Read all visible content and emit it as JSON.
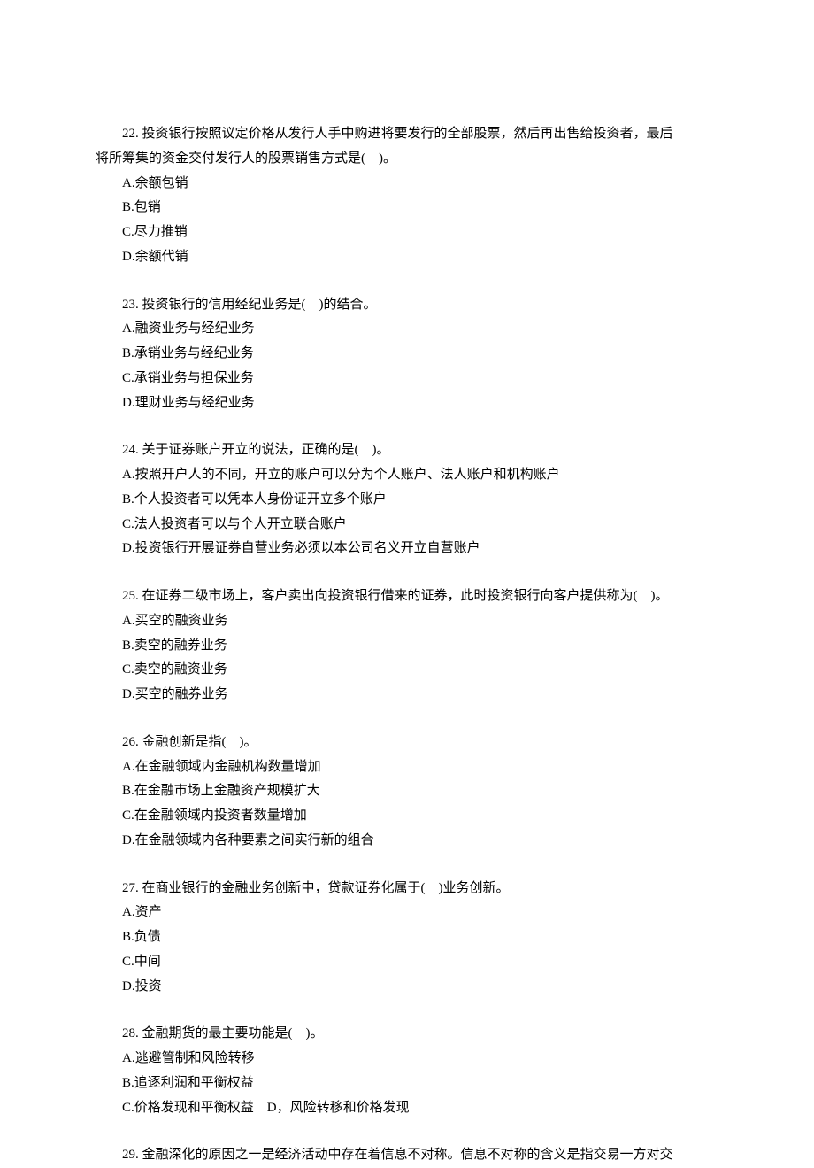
{
  "questions": [
    {
      "num": "22.",
      "stem_lines": [
        "投资银行按照议定价格从发行人手中购进将要发行的全部股票，然后再出售给投资者，最后",
        "将所筹集的资金交付发行人的股票销售方式是(　)。"
      ],
      "options": [
        "A.余额包销",
        "B.包销",
        "C.尽力推销",
        "D.余额代销"
      ]
    },
    {
      "num": "23.",
      "stem_lines": [
        "投资银行的信用经纪业务是(　)的结合。"
      ],
      "options": [
        "A.融资业务与经纪业务",
        "B.承销业务与经纪业务",
        "C.承销业务与担保业务",
        "D.理财业务与经纪业务"
      ]
    },
    {
      "num": "24.",
      "stem_lines": [
        "关于证券账户开立的说法，正确的是(　)。"
      ],
      "options": [
        "A.按照开户人的不同，开立的账户可以分为个人账户、法人账户和机构账户",
        "B.个人投资者可以凭本人身份证开立多个账户",
        "C.法人投资者可以与个人开立联合账户",
        "D.投资银行开展证券自营业务必须以本公司名义开立自营账户"
      ]
    },
    {
      "num": "25.",
      "stem_lines": [
        "在证券二级市场上，客户卖出向投资银行借来的证券，此时投资银行向客户提供称为(　)。"
      ],
      "options": [
        "A.买空的融资业务",
        "B.卖空的融券业务",
        "C.卖空的融资业务",
        "D.买空的融券业务"
      ]
    },
    {
      "num": "26.",
      "stem_lines": [
        "金融创新是指(　)。"
      ],
      "options": [
        "A.在金融领域内金融机构数量增加",
        "B.在金融市场上金融资产规模扩大",
        "C.在金融领域内投资者数量增加",
        "D.在金融领域内各种要素之间实行新的组合"
      ]
    },
    {
      "num": "27.",
      "stem_lines": [
        "在商业银行的金融业务创新中，贷款证券化属于(　)业务创新。"
      ],
      "options": [
        "A.资产",
        "B.负债",
        "C.中间",
        "D.投资"
      ]
    },
    {
      "num": "28.",
      "stem_lines": [
        "金融期货的最主要功能是(　)。"
      ],
      "options": [
        "A.逃避管制和风险转移",
        "B.追逐利润和平衡权益",
        "C.价格发现和平衡权益 D，风险转移和价格发现"
      ]
    },
    {
      "num": "29.",
      "stem_lines": [
        "金融深化的原因之一是经济活动中存在着信息不对称。信息不对称的含义是指交易一方对交"
      ],
      "options": []
    }
  ]
}
